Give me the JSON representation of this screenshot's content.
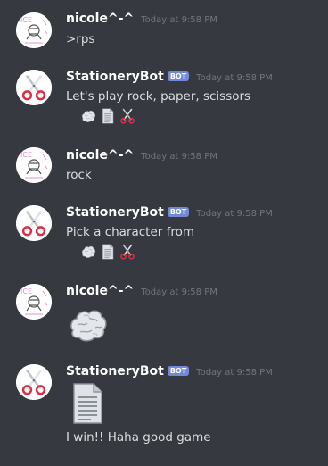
{
  "colors": {
    "background": "#36393f",
    "username": "#ffffff",
    "message_text": "#dcddde",
    "timestamp": "#72767d",
    "bot_tag": "#7289da"
  },
  "messages": [
    {
      "author": "nicole^-^",
      "bot": false,
      "timestamp": "Today at 9:58 PM",
      "text": ">rps",
      "avatar_icon": "user-drawing-avatar-icon"
    },
    {
      "author": "StationeryBot",
      "bot": true,
      "bot_tag": "BOT",
      "timestamp": "Today at 9:58 PM",
      "text": "Let's play rock, paper, scissors",
      "emojis": [
        "rock-icon",
        "paper-icon",
        "scissors-icon"
      ],
      "avatar_icon": "scissors-avatar-icon"
    },
    {
      "author": "nicole^-^",
      "bot": false,
      "timestamp": "Today at 9:58 PM",
      "text": "rock",
      "avatar_icon": "user-drawing-avatar-icon"
    },
    {
      "author": "StationeryBot",
      "bot": true,
      "bot_tag": "BOT",
      "timestamp": "Today at 9:58 PM",
      "text": "Pick a character from",
      "emojis": [
        "rock-icon",
        "paper-icon",
        "scissors-icon"
      ],
      "avatar_icon": "scissors-avatar-icon"
    },
    {
      "author": "nicole^-^",
      "bot": false,
      "timestamp": "Today at 9:58 PM",
      "big_emoji": "rock-icon",
      "avatar_icon": "user-drawing-avatar-icon"
    },
    {
      "author": "StationeryBot",
      "bot": true,
      "bot_tag": "BOT",
      "timestamp": "Today at 9:58 PM",
      "big_emoji": "paper-icon",
      "text": "I win!! Haha good game",
      "avatar_icon": "scissors-avatar-icon"
    }
  ]
}
